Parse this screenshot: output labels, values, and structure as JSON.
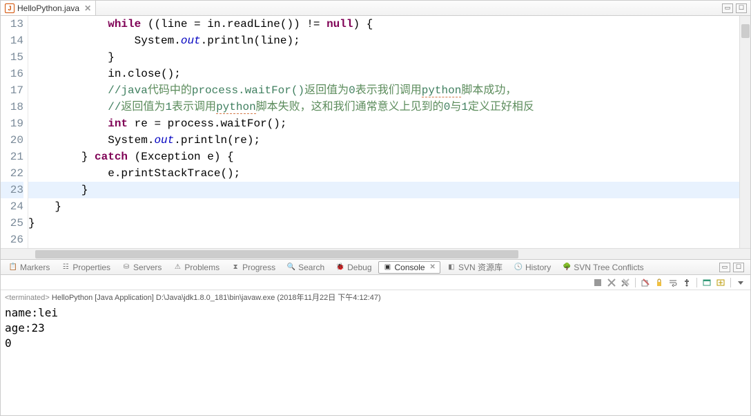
{
  "editor": {
    "tab": {
      "filename": "HelloPython.java",
      "close_x": "✕"
    },
    "win": {
      "min": "▭",
      "max": "☐"
    },
    "gutter": [
      "13",
      "14",
      "15",
      "16",
      "17",
      "18",
      "19",
      "20",
      "21",
      "22",
      "23",
      "24",
      "25",
      "26"
    ],
    "lines": {
      "l13": {
        "pre": "            ",
        "kw": "while",
        "rest1": " ((line = in.readLine()) != ",
        "kw2": "null",
        "rest2": ") {"
      },
      "l14": {
        "pre": "                System.",
        "field": "out",
        "rest": ".println(line);"
      },
      "l15": "            }",
      "l16": "            in.close();",
      "l17": {
        "pre": "            ",
        "c1": "//java",
        "cjk1": "代码中的",
        "c2": "process.waitFor()",
        "cjk2": "返回值为",
        "c3": "0",
        "cjk3": "表示我们调用",
        "u1": "python",
        "cjk4": "脚本成功，"
      },
      "l18": {
        "pre": "            ",
        "c1": "//",
        "cjk1": "返回值为",
        "c2": "1",
        "cjk2": "表示调用",
        "u1": "python",
        "cjk3": "脚本失败，这和我们通常意义上见到的",
        "c3": "0",
        "cjk4": "与",
        "c4": "1",
        "cjk5": "定义正好相反"
      },
      "l19": {
        "pre": "            ",
        "kw": "int",
        "rest": " re = process.waitFor();"
      },
      "l20": {
        "pre": "            System.",
        "field": "out",
        "rest": ".println(re);"
      },
      "l21": {
        "pre": "        } ",
        "kw": "catch",
        "rest": " (Exception e) {"
      },
      "l22": "            e.printStackTrace();",
      "l23": "        }",
      "l24": "    }",
      "l25": "}",
      "l26": ""
    }
  },
  "views": {
    "markers": "Markers",
    "properties": "Properties",
    "servers": "Servers",
    "problems": "Problems",
    "progress": "Progress",
    "search": "Search",
    "debug": "Debug",
    "console": "Console",
    "svn_repo": "SVN 资源库",
    "history": "History",
    "svn_tree": "SVN Tree Conflicts"
  },
  "console": {
    "status": {
      "term": "<terminated>",
      "rest": " HelloPython [Java Application] D:\\Java\\jdk1.8.0_181\\bin\\javaw.exe (2018年11月22日 下午4:12:47)"
    },
    "out": [
      "name:lei",
      "age:23",
      "0"
    ]
  }
}
